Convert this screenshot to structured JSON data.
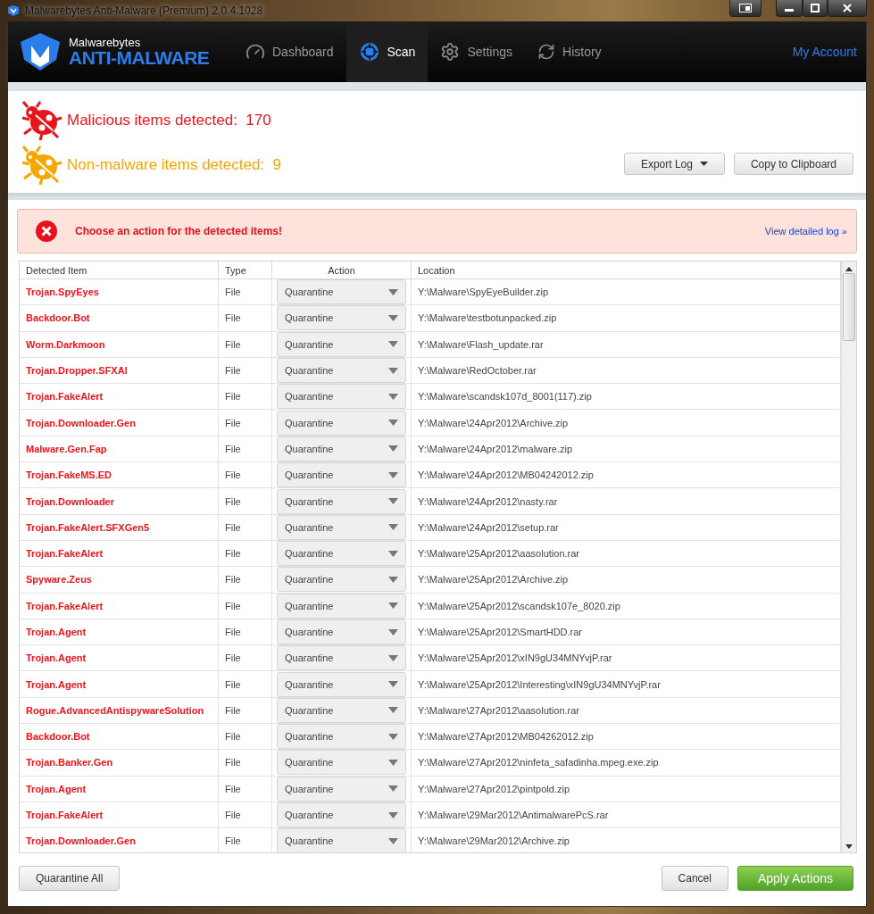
{
  "window": {
    "title": "Malwarebytes Anti-Malware (Premium) 2.0.4.1028"
  },
  "brand": {
    "top": "Malwarebytes",
    "bottom": "ANTI-MALWARE"
  },
  "tabs": [
    {
      "label": "Dashboard",
      "kind": "dashboard",
      "selected": false
    },
    {
      "label": "Scan",
      "kind": "scan",
      "selected": true
    },
    {
      "label": "Settings",
      "kind": "settings",
      "selected": false
    },
    {
      "label": "History",
      "kind": "history",
      "selected": false
    }
  ],
  "account_link": "My Account",
  "summary": [
    {
      "kind": "malicious",
      "label": "Malicious items detected:",
      "count": "170"
    },
    {
      "kind": "nonmalware",
      "label": "Non-malware items detected:",
      "count": "9"
    }
  ],
  "export_button": "Export Log",
  "copy_button": "Copy to Clipboard",
  "alert": {
    "message": "Choose an action for the detected items!",
    "link": "View detailed log »"
  },
  "table": {
    "columns": [
      "Detected Item",
      "Type",
      "Action",
      "Location"
    ],
    "rows": [
      {
        "item": "Trojan.SpyEyes",
        "type": "File",
        "action": "Quarantine",
        "location": "Y:\\Malware\\SpyEyeBuilder.zip"
      },
      {
        "item": "Backdoor.Bot",
        "type": "File",
        "action": "Quarantine",
        "location": "Y:\\Malware\\testbotunpacked.zip"
      },
      {
        "item": "Worm.Darkmoon",
        "type": "File",
        "action": "Quarantine",
        "location": "Y:\\Malware\\Flash_update.rar"
      },
      {
        "item": "Trojan.Dropper.SFXAI",
        "type": "File",
        "action": "Quarantine",
        "location": "Y:\\Malware\\RedOctober.rar"
      },
      {
        "item": "Trojan.FakeAlert",
        "type": "File",
        "action": "Quarantine",
        "location": "Y:\\Malware\\scandsk107d_8001(117).zip"
      },
      {
        "item": "Trojan.Downloader.Gen",
        "type": "File",
        "action": "Quarantine",
        "location": "Y:\\Malware\\24Apr2012\\Archive.zip"
      },
      {
        "item": "Malware.Gen.Fap",
        "type": "File",
        "action": "Quarantine",
        "location": "Y:\\Malware\\24Apr2012\\malware.zip"
      },
      {
        "item": "Trojan.FakeMS.ED",
        "type": "File",
        "action": "Quarantine",
        "location": "Y:\\Malware\\24Apr2012\\MB04242012.zip"
      },
      {
        "item": "Trojan.Downloader",
        "type": "File",
        "action": "Quarantine",
        "location": "Y:\\Malware\\24Apr2012\\nasty.rar"
      },
      {
        "item": "Trojan.FakeAlert.SFXGen5",
        "type": "File",
        "action": "Quarantine",
        "location": "Y:\\Malware\\24Apr2012\\setup.rar"
      },
      {
        "item": "Trojan.FakeAlert",
        "type": "File",
        "action": "Quarantine",
        "location": "Y:\\Malware\\25Apr2012\\aasolution.rar"
      },
      {
        "item": "Spyware.Zeus",
        "type": "File",
        "action": "Quarantine",
        "location": "Y:\\Malware\\25Apr2012\\Archive.zip"
      },
      {
        "item": "Trojan.FakeAlert",
        "type": "File",
        "action": "Quarantine",
        "location": "Y:\\Malware\\25Apr2012\\scandsk107e_8020.zip"
      },
      {
        "item": "Trojan.Agent",
        "type": "File",
        "action": "Quarantine",
        "location": "Y:\\Malware\\25Apr2012\\SmartHDD.rar"
      },
      {
        "item": "Trojan.Agent",
        "type": "File",
        "action": "Quarantine",
        "location": "Y:\\Malware\\25Apr2012\\xIN9gU34MNYvjP.rar"
      },
      {
        "item": "Trojan.Agent",
        "type": "File",
        "action": "Quarantine",
        "location": "Y:\\Malware\\25Apr2012\\Interesting\\xIN9gU34MNYvjP.rar"
      },
      {
        "item": "Rogue.AdvancedAntispywareSolution",
        "type": "File",
        "action": "Quarantine",
        "location": "Y:\\Malware\\27Apr2012\\aasolution.rar"
      },
      {
        "item": "Backdoor.Bot",
        "type": "File",
        "action": "Quarantine",
        "location": "Y:\\Malware\\27Apr2012\\MB04262012.zip"
      },
      {
        "item": "Trojan.Banker.Gen",
        "type": "File",
        "action": "Quarantine",
        "location": "Y:\\Malware\\27Apr2012\\ninfeta_safadinha.mpeg.exe.zip"
      },
      {
        "item": "Trojan.Agent",
        "type": "File",
        "action": "Quarantine",
        "location": "Y:\\Malware\\27Apr2012\\pintpold.zip"
      },
      {
        "item": "Trojan.FakeAlert",
        "type": "File",
        "action": "Quarantine",
        "location": "Y:\\Malware\\29Mar2012\\AntimalwarePcS.rar"
      },
      {
        "item": "Trojan.Downloader.Gen",
        "type": "File",
        "action": "Quarantine",
        "location": "Y:\\Malware\\29Mar2012\\Archive.zip"
      }
    ]
  },
  "footer_buttons": [
    {
      "label": "Quarantine All",
      "kind": "secondary"
    },
    {
      "label": "Cancel",
      "kind": "secondary"
    },
    {
      "label": "Apply Actions",
      "kind": "primary"
    }
  ]
}
